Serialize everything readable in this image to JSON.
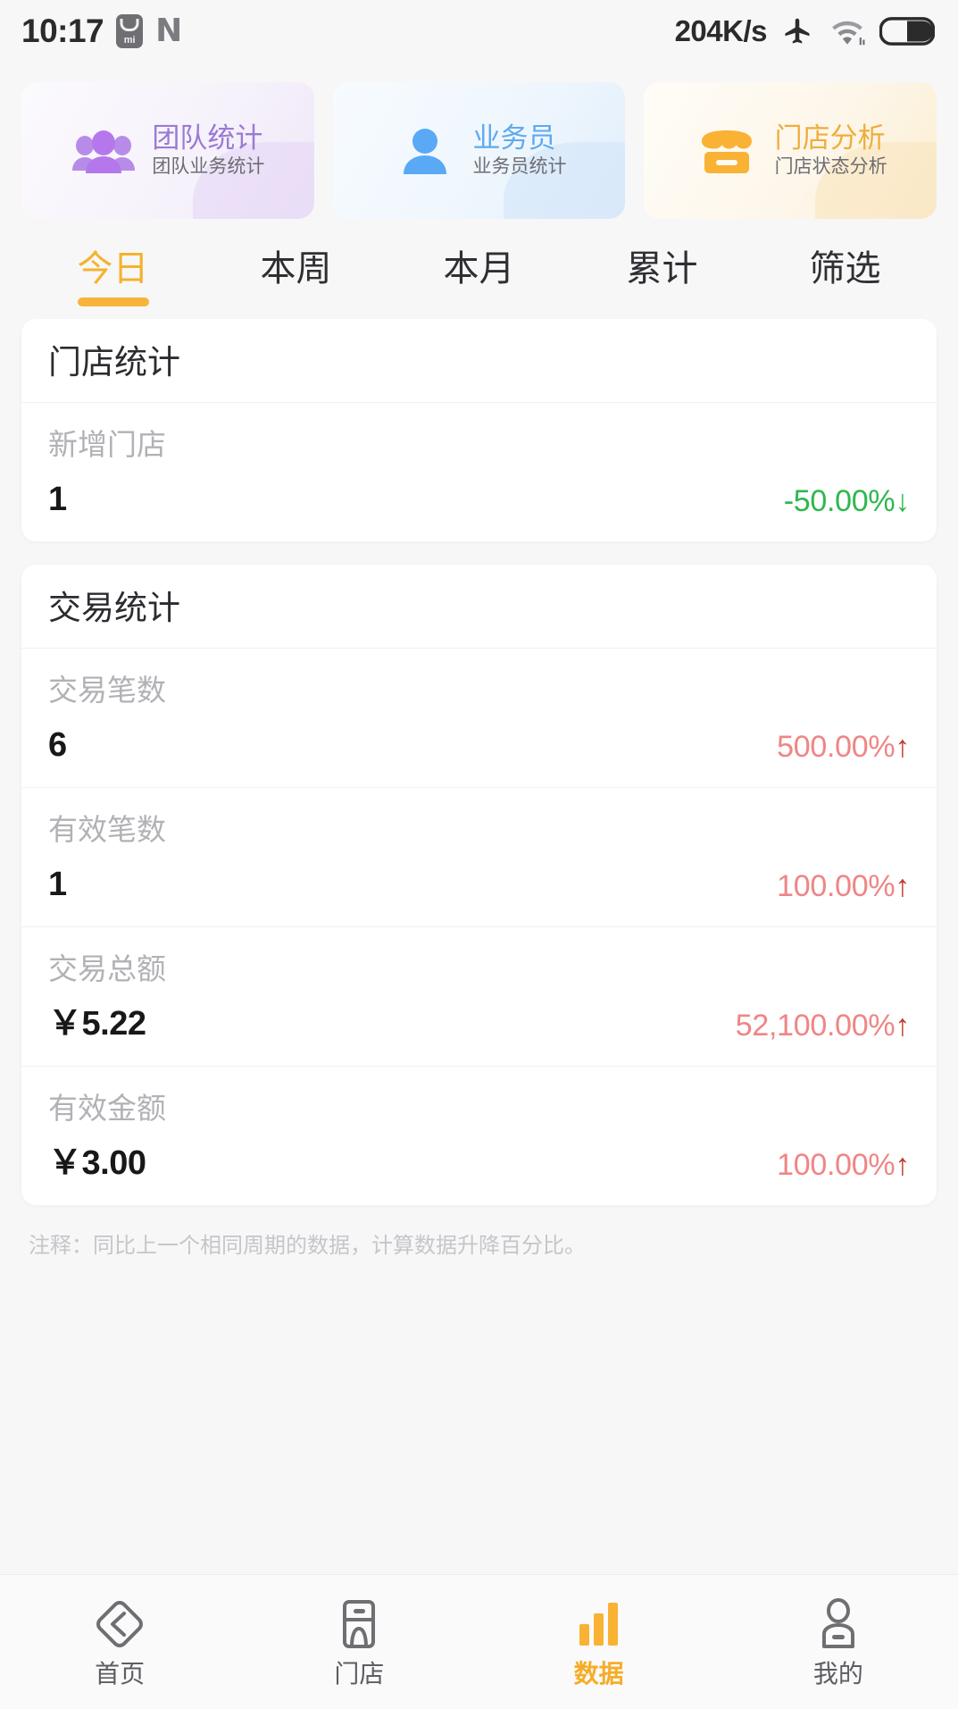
{
  "status_bar": {
    "time": "10:17",
    "mi_badge_text": "mi",
    "n_icon": "N",
    "network_speed": "204K/s",
    "icons": [
      "airplane-mode-icon",
      "wifi-icon",
      "battery-icon"
    ]
  },
  "shortcuts": [
    {
      "title": "团队统计",
      "subtitle": "团队业务统计",
      "icon": "group-people-icon",
      "color": "#9b7ad4"
    },
    {
      "title": "业务员",
      "subtitle": "业务员统计",
      "icon": "person-icon",
      "color": "#5fa9f0"
    },
    {
      "title": "门店分析",
      "subtitle": "门店状态分析",
      "icon": "storefront-icon",
      "color": "#f0ad3c"
    }
  ],
  "tabs": [
    {
      "label": "今日",
      "active": true
    },
    {
      "label": "本周",
      "active": false
    },
    {
      "label": "本月",
      "active": false
    },
    {
      "label": "累计",
      "active": false
    },
    {
      "label": "筛选",
      "active": false
    }
  ],
  "cards": [
    {
      "title": "门店统计",
      "metrics": [
        {
          "label": "新增门店",
          "value": "1",
          "delta": "-50.00%",
          "arrow": "↓",
          "direction": "down"
        }
      ]
    },
    {
      "title": "交易统计",
      "metrics": [
        {
          "label": "交易笔数",
          "value": "6",
          "delta": "500.00%",
          "arrow": "↑",
          "direction": "up"
        },
        {
          "label": "有效笔数",
          "value": "1",
          "delta": "100.00%",
          "arrow": "↑",
          "direction": "up"
        },
        {
          "label": "交易总额",
          "value": "￥5.22",
          "delta": "52,100.00%",
          "arrow": "↑",
          "direction": "up"
        },
        {
          "label": "有效金额",
          "value": "￥3.00",
          "delta": "100.00%",
          "arrow": "↑",
          "direction": "up"
        }
      ]
    }
  ],
  "footnote": "注释：同比上一个相同周期的数据，计算数据升降百分比。",
  "bottom_nav": [
    {
      "label": "首页",
      "icon": "home-diamond-icon",
      "active": false
    },
    {
      "label": "门店",
      "icon": "store-icon",
      "active": false
    },
    {
      "label": "数据",
      "icon": "bar-chart-icon",
      "active": true
    },
    {
      "label": "我的",
      "icon": "profile-icon",
      "active": false
    }
  ],
  "colors": {
    "accent": "#f5b22c",
    "up": "#f08585",
    "down": "#2eb84e"
  }
}
